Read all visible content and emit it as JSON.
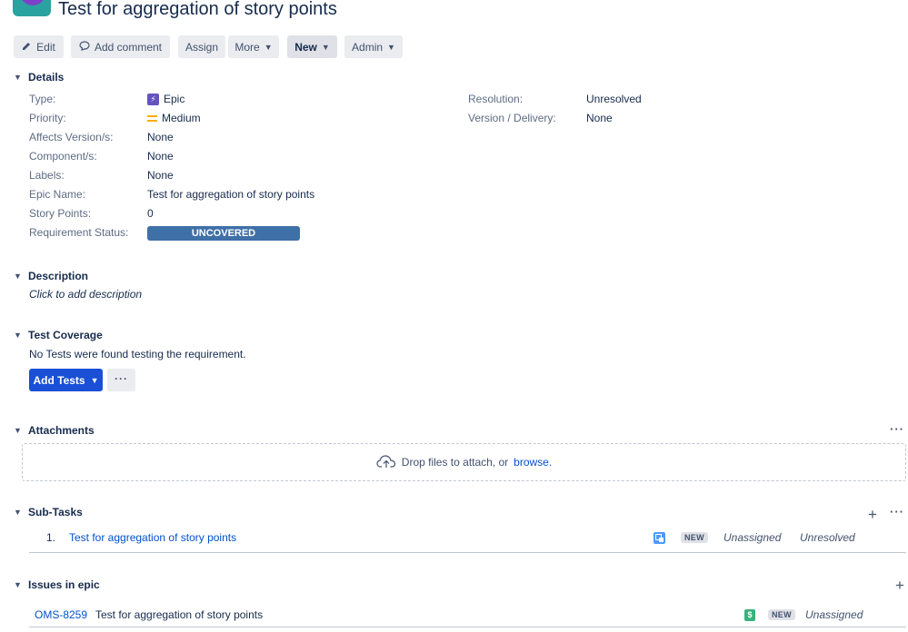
{
  "header": {
    "title": "Test for aggregation of story points"
  },
  "toolbar": {
    "edit_label": "Edit",
    "comment_label": "Add comment",
    "assign_label": "Assign",
    "more_label": "More",
    "new_label": "New",
    "admin_label": "Admin"
  },
  "details": {
    "heading": "Details",
    "left": [
      {
        "label": "Type:",
        "value": "Epic",
        "icon": "epic-icon"
      },
      {
        "label": "Priority:",
        "value": "Medium",
        "icon": "priority-medium-icon"
      },
      {
        "label": "Affects Version/s:",
        "value": "None"
      },
      {
        "label": "Component/s:",
        "value": "None"
      },
      {
        "label": "Labels:",
        "value": "None"
      },
      {
        "label": "Epic Name:",
        "value": "Test for aggregation of story points"
      },
      {
        "label": "Story Points:",
        "value": "0"
      },
      {
        "label": "Requirement Status:",
        "value": "UNCOVERED"
      }
    ],
    "right": [
      {
        "label": "Resolution:",
        "value": "Unresolved"
      },
      {
        "label": "Version / Delivery:",
        "value": "None"
      }
    ]
  },
  "description": {
    "heading": "Description",
    "placeholder": "Click to add description"
  },
  "test_coverage": {
    "heading": "Test Coverage",
    "message": "No Tests were found testing the requirement.",
    "add_tests_label": "Add Tests",
    "more_label": "···"
  },
  "attachments": {
    "heading": "Attachments",
    "drop_text": "Drop files to attach, or",
    "browse_label": "browse.",
    "more_label": "···"
  },
  "subtasks": {
    "heading": "Sub-Tasks",
    "more_label": "···",
    "add_label": "+",
    "items": [
      {
        "index": "1.",
        "summary": "Test for aggregation of story points",
        "status": "NEW",
        "assignee": "Unassigned",
        "resolution": "Unresolved",
        "icon": "subtask-icon"
      }
    ]
  },
  "issues_in_epic": {
    "heading": "Issues in epic",
    "add_label": "+",
    "items": [
      {
        "key": "OMS-8259",
        "summary": "Test for aggregation of story points",
        "status": "NEW",
        "assignee": "Unassigned",
        "icon": "story-dollar-icon"
      }
    ]
  },
  "colors": {
    "primary_button": "#1a4fd6",
    "requirement_status": "#3f70a7",
    "link": "#0052cc",
    "epic_icon": "#6554c0",
    "priority_medium": "#ffab00"
  }
}
